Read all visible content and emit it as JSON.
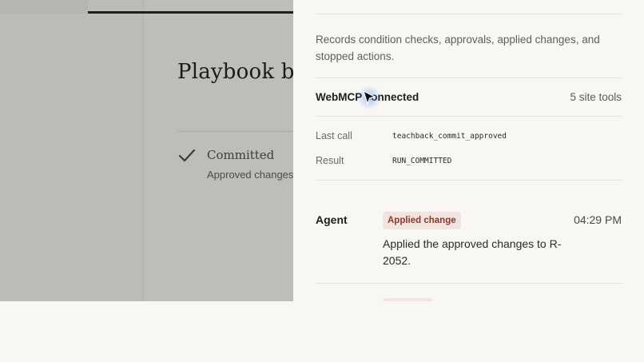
{
  "app": {
    "page_title": "Playbook b",
    "status": {
      "title": "Committed",
      "subtitle": "Approved changes"
    }
  },
  "panel": {
    "description": "Records condition checks, approvals, applied changes, and stopped actions.",
    "connection": {
      "label": "WebMCP connected",
      "tools_count": "5 site tools"
    },
    "last_call": {
      "label": "Last call",
      "value": "teachback_commit_approved"
    },
    "result": {
      "label": "Result",
      "value": "RUN_COMMITTED"
    },
    "log": [
      {
        "actor": "Agent",
        "badge": "Applied change",
        "time": "04:29 PM",
        "message": "Applied the approved changes to R-2052."
      }
    ]
  },
  "colors": {
    "overlay": "#bdbdba",
    "panel_bg": "#f8f7f4",
    "badge_bg": "#f1e3df",
    "badge_text": "#8a3a26",
    "cursor_glow": "#4a84ff"
  },
  "icons": {
    "status": "check-icon",
    "pointer": "cursor-icon"
  }
}
